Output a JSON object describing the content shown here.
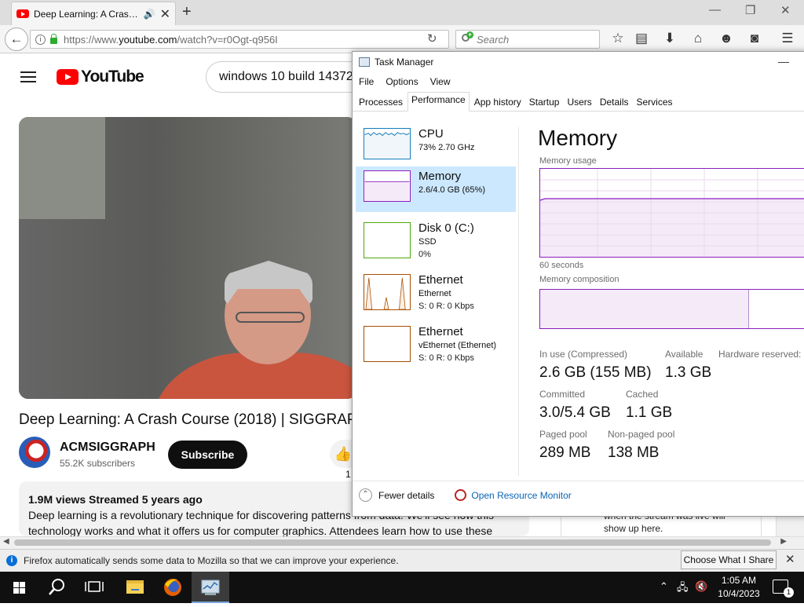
{
  "browser": {
    "tab_title": "Deep Learning: A Cras…",
    "url_prefix": "https://www.",
    "url_domain": "youtube.com",
    "url_path": "/watch?v=r0Ogt-q956I",
    "search_placeholder": "Search"
  },
  "youtube": {
    "logo_text": "YouTube",
    "search_value": "windows 10 build 14372",
    "video_title": "Deep Learning: A Crash Course (2018) | SIGGRAPH",
    "channel_name": "ACMSIGGRAPH",
    "subscribers": "55.2K subscribers",
    "subscribe_label": "Subscribe",
    "like_count": "1",
    "views_meta": "1.9M views  Streamed 5 years ago",
    "description_line1": "Deep learning is a revolutionary technique for discovering patterns from data. We'll see how this",
    "description_line2": "technology works and what it offers us for computer graphics. Attendees learn how to use these",
    "chat_text_1": "when the stream was live will",
    "chat_text_2": "show up here."
  },
  "notification": {
    "text": "Firefox automatically sends some data to Mozilla so that we can improve your experience.",
    "button": "Choose What I Share"
  },
  "taskmanager": {
    "title": "Task Manager",
    "menu": [
      "File",
      "Options",
      "View"
    ],
    "tabs": [
      "Processes",
      "Performance",
      "App history",
      "Startup",
      "Users",
      "Details",
      "Services"
    ],
    "active_tab": "Performance",
    "sidebar": [
      {
        "name": "CPU",
        "line1": "73%  2.70 GHz",
        "line2": ""
      },
      {
        "name": "Memory",
        "line1": "2.6/4.0 GB (65%)",
        "line2": ""
      },
      {
        "name": "Disk 0 (C:)",
        "line1": "SSD",
        "line2": "0%"
      },
      {
        "name": "Ethernet",
        "line1": "Ethernet",
        "line2": "S: 0  R: 0 Kbps"
      },
      {
        "name": "Ethernet",
        "line1": "vEthernet (Ethernet)",
        "line2": "S: 0  R: 0 Kbps"
      }
    ],
    "heading": "Memory",
    "usage_label": "Memory usage",
    "seconds_label": "60 seconds",
    "composition_label": "Memory composition",
    "stats": {
      "in_use_label": "In use (Compressed)",
      "in_use_value": "2.6 GB (155 MB)",
      "available_label": "Available",
      "available_value": "1.3 GB",
      "hw_reserved_label": "Hardware reserved:",
      "committed_label": "Committed",
      "committed_value": "3.0/5.4 GB",
      "cached_label": "Cached",
      "cached_value": "1.1 GB",
      "paged_label": "Paged pool",
      "paged_value": "289 MB",
      "nonpaged_label": "Non-paged pool",
      "nonpaged_value": "138 MB"
    },
    "fewer_details": "Fewer details",
    "resource_monitor": "Open Resource Monitor"
  },
  "taskbar": {
    "time": "1:05 AM",
    "date": "10/4/2023",
    "notification_count": "1"
  },
  "colors": {
    "memory_purple": "#8b1ebd",
    "selected_bg": "#cce8ff",
    "youtube_red": "#ff0000"
  }
}
